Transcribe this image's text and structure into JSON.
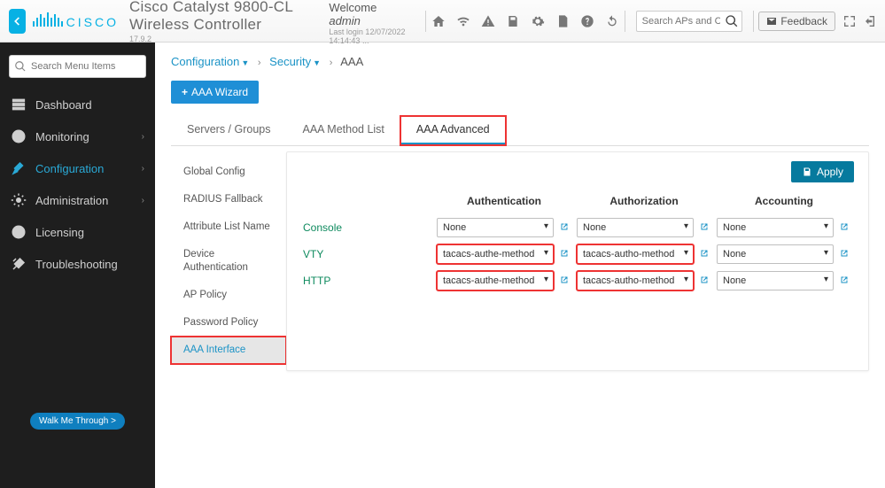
{
  "header": {
    "title": "Cisco Catalyst 9800-CL Wireless Controller",
    "version": "17.9.2",
    "logo_text": "CISCO",
    "welcome_prefix": "Welcome ",
    "welcome_user": "admin",
    "last_login": "Last login 12/07/2022 14:14:43 ...",
    "feedback_label": "Feedback",
    "search_placeholder": "Search APs and Clients"
  },
  "sidebar": {
    "search_placeholder": "Search Menu Items",
    "items": [
      {
        "label": "Dashboard"
      },
      {
        "label": "Monitoring",
        "chevron": true
      },
      {
        "label": "Configuration",
        "chevron": true,
        "active": true
      },
      {
        "label": "Administration",
        "chevron": true
      },
      {
        "label": "Licensing"
      },
      {
        "label": "Troubleshooting"
      }
    ],
    "walkme": "Walk Me Through >"
  },
  "breadcrumb": {
    "a": "Configuration",
    "b": "Security",
    "c": "AAA"
  },
  "wizard_label": "AAA Wizard",
  "tabs": [
    {
      "label": "Servers / Groups"
    },
    {
      "label": "AAA Method List"
    },
    {
      "label": "AAA Advanced",
      "active": true,
      "highlight": true
    }
  ],
  "inner_nav": [
    {
      "label": "Global Config"
    },
    {
      "label": "RADIUS Fallback"
    },
    {
      "label": "Attribute List Name"
    },
    {
      "label": "Device Authentication"
    },
    {
      "label": "AP Policy"
    },
    {
      "label": "Password Policy"
    },
    {
      "label": "AAA Interface",
      "selected": true,
      "highlight": true
    }
  ],
  "panel": {
    "apply_label": "Apply",
    "columns": [
      "Authentication",
      "Authorization",
      "Accounting"
    ],
    "rows": [
      {
        "label": "Console",
        "cells": [
          {
            "value": "None",
            "highlight": false
          },
          {
            "value": "None",
            "highlight": false
          },
          {
            "value": "None",
            "highlight": false
          }
        ]
      },
      {
        "label": "VTY",
        "cells": [
          {
            "value": "tacacs-authe-method",
            "highlight": true
          },
          {
            "value": "tacacs-autho-method",
            "highlight": true
          },
          {
            "value": "None",
            "highlight": false
          }
        ]
      },
      {
        "label": "HTTP",
        "cells": [
          {
            "value": "tacacs-authe-method",
            "highlight": true
          },
          {
            "value": "tacacs-autho-method",
            "highlight": true
          },
          {
            "value": "None",
            "highlight": false
          }
        ]
      }
    ]
  }
}
